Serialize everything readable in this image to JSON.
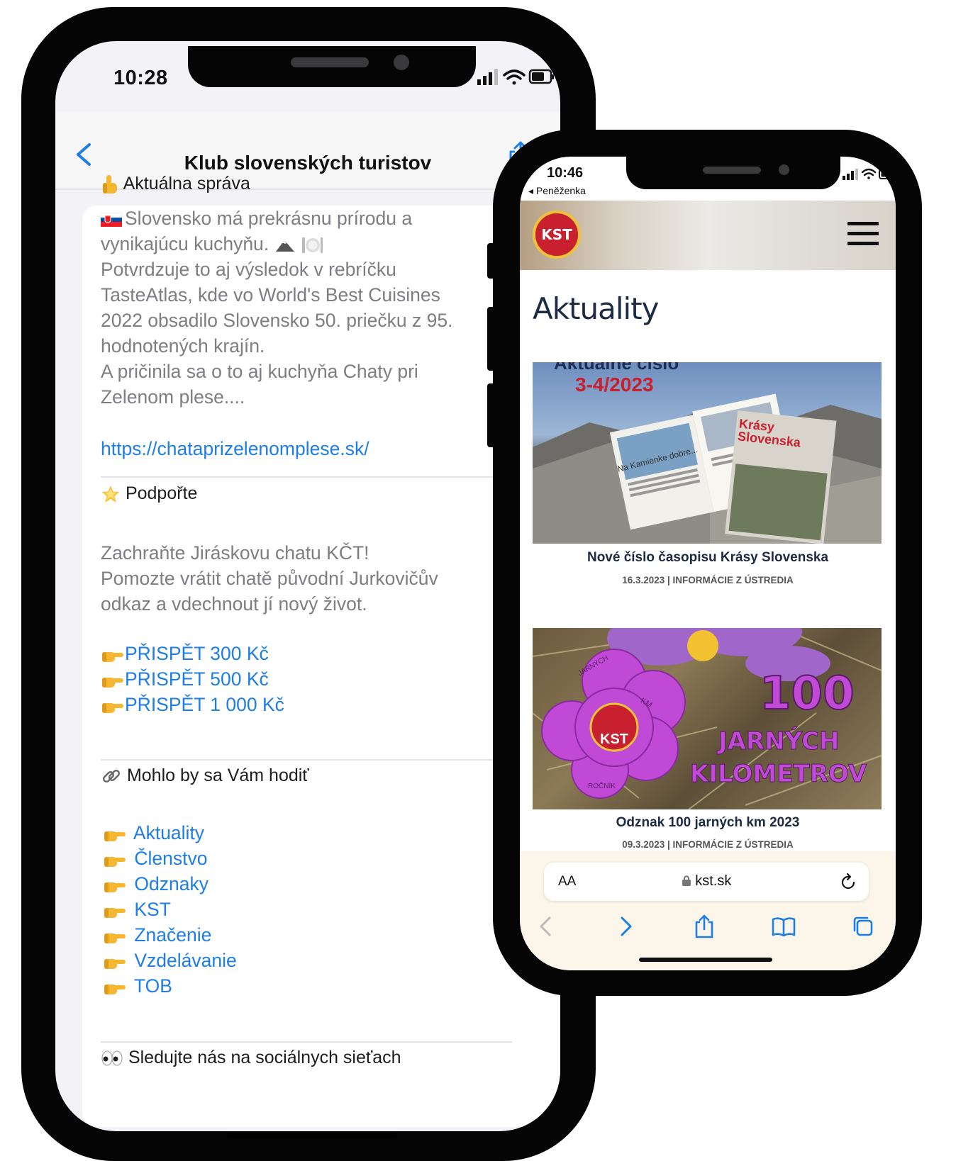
{
  "phone1": {
    "status_time": "10:28",
    "nav_title": "Klub slovenských turistov",
    "section_news": {
      "header": "Aktuálna správa",
      "paragraph_lines": [
        "Slovensko má prekrásnu prírodu a",
        "vynikajúcu kuchyňu.",
        "Potvrdzuje to aj výsledok v rebríčku",
        "TasteAtlas, kde vo World's Best Cuisines",
        "2022 obsadilo Slovensko 50. priečku z 95.",
        "hodnotených krajín.",
        "A pričinila sa o to aj kuchyňa Chaty pri",
        "Zelenom plese...."
      ],
      "link": "https://chataprizelenomplese.sk/"
    },
    "section_support": {
      "header": "Podpořte",
      "paragraph_lines": [
        "Zachraňte Jiráskovu chatu KČT!",
        "Pomozte vrátit chatě původní Jurkovičův",
        "odkaz a vdechnout jí nový život."
      ],
      "donate_links": [
        "PŘISPĚT 300 Kč",
        "PŘISPĚT 500 Kč",
        "PŘISPĚT 1 000 Kč"
      ]
    },
    "section_useful": {
      "header": "Mohlo by sa Vám hodiť",
      "links": [
        "Aktuality",
        "Členstvo",
        "Odznaky",
        "KST",
        "Značenie",
        "Vzdelávanie",
        "TOB"
      ]
    },
    "section_social": {
      "header": "Sledujte nás na sociálnych sieťach"
    }
  },
  "phone2": {
    "status_time": "10:46",
    "back_app": "◂ Peněženka",
    "logo_text": "KST",
    "page_heading": "Aktuality",
    "articles": [
      {
        "image_text_top": "Aktuálne číslo",
        "image_text_issue": "3-4/2023",
        "image_magazine_title_1": "Krásy",
        "image_magazine_title_2": "Slovenska",
        "image_page_text": "Na Kamienke dobre...",
        "title": "Nové číslo časopisu Krásy Slovenska",
        "meta": "16.3.2023 | INFORMÁCIE Z ÚSTREDIA"
      },
      {
        "image_text_big": "100",
        "image_text_line1": "JARNÝCH",
        "image_text_line2": "KILOMETROV",
        "badge_center": "KST",
        "badge_text_top": "JARNÝCH",
        "badge_text_right": "KM",
        "badge_text_bottom": "ROČNÍK",
        "title": "Odznak 100 jarných km 2023",
        "meta": "09.3.2023 | INFORMÁCIE Z ÚSTREDIA"
      }
    ],
    "safari": {
      "aa_label": "AA",
      "url": "kst.sk"
    }
  },
  "colors": {
    "link_blue": "#1e7de6",
    "heading_navy": "#1c2a44",
    "badge_purple": "#c04ad6",
    "issue_red": "#c8202e"
  }
}
